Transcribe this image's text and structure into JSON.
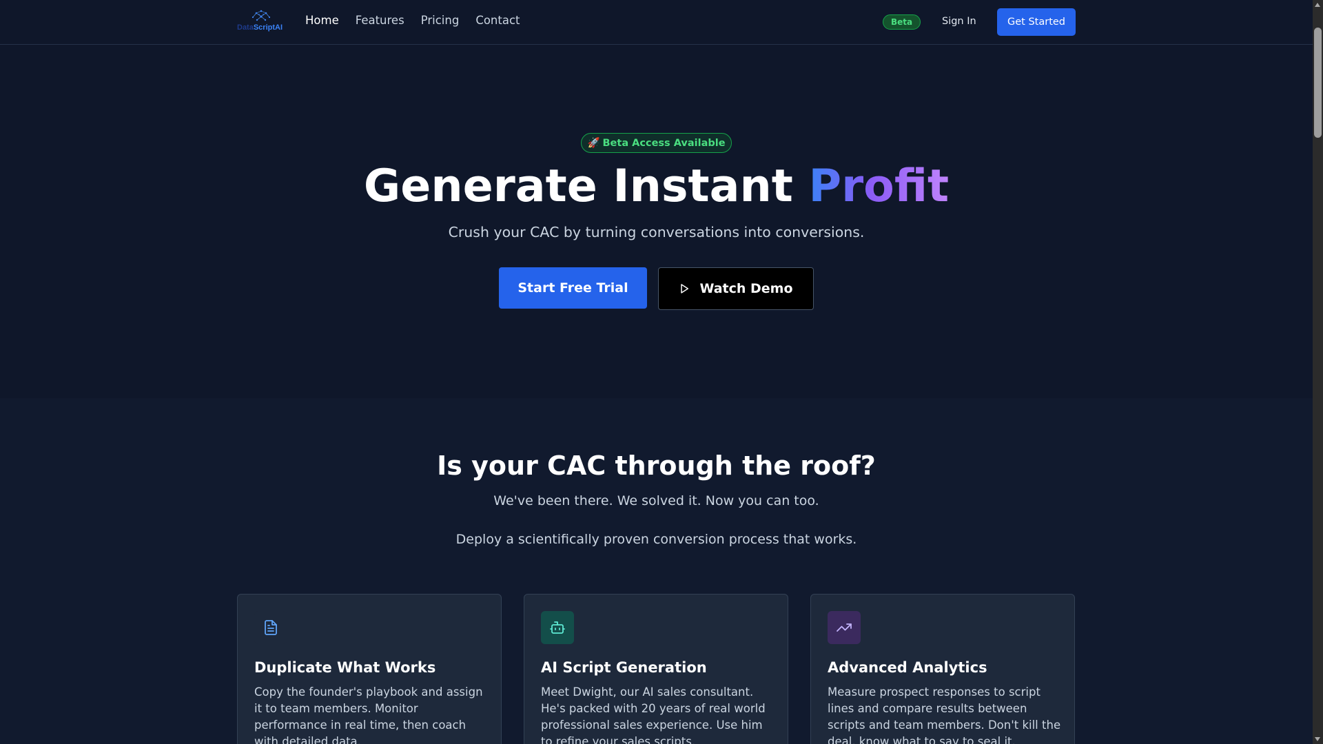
{
  "brand": {
    "logo_part1": "Data",
    "logo_part2": "ScriptAI"
  },
  "nav": {
    "items": [
      {
        "label": "Home"
      },
      {
        "label": "Features"
      },
      {
        "label": "Pricing"
      },
      {
        "label": "Contact"
      }
    ],
    "active": "Home",
    "beta_label": "Beta",
    "sign_in": "Sign In",
    "get_started": "Get Started"
  },
  "hero": {
    "badge_emoji": "🚀",
    "badge_text": "Beta Access Available",
    "title_plain": "Generate Instant ",
    "title_accent": "Profit",
    "subtitle": "Crush your CAC by turning conversations into conversions.",
    "primary_cta": "Start Free Trial",
    "secondary_cta": "Watch Demo"
  },
  "problem": {
    "title": "Is your CAC through the roof?",
    "subtitle": "We've been there. We solved it. Now you can too.",
    "tagline": "Deploy a scientifically proven conversion process that works."
  },
  "features": [
    {
      "icon": "document-icon",
      "title": "Duplicate What Works",
      "description": "Copy the founder's playbook and assign it to team members. Monitor performance in real time, then coach with detailed data."
    },
    {
      "icon": "bot-icon",
      "title": "AI Script Generation",
      "description": "Meet Dwight, our AI sales consultant. He's packed with 20 years of real world professional sales experience. Use him to refine your sales scripts."
    },
    {
      "icon": "trending-up-icon",
      "title": "Advanced Analytics",
      "description": "Measure prospect responses to script lines and compare results between scripts and team members. Don't kill the deal, know what to say to seal it."
    }
  ],
  "colors": {
    "background": "#0f172a",
    "section_alt": "#111a2e",
    "card": "#1e293b",
    "primary": "#2563eb",
    "success": "#4ade80",
    "accent_purple": "#8b5cf6"
  }
}
